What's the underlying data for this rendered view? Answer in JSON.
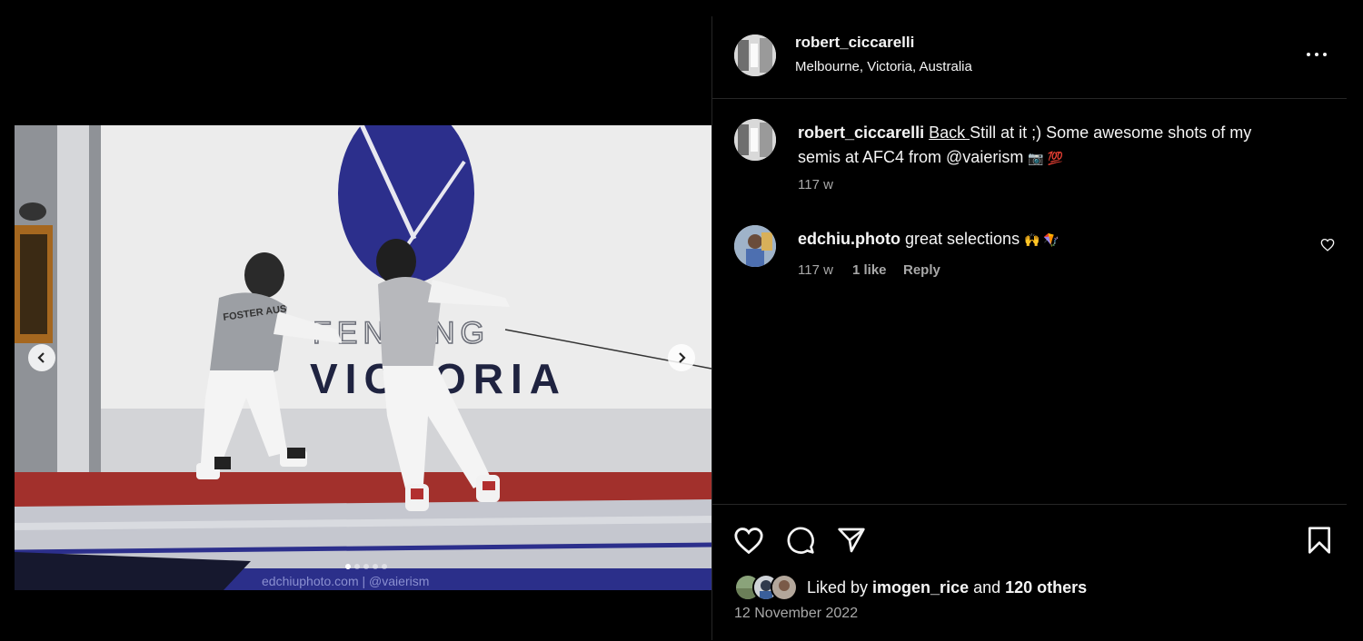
{
  "post": {
    "watermark": "edchiuphoto.com | @vaierism",
    "banner_top": "FENCING",
    "banner_bottom": "VICTORIA",
    "fencer_back": "FOSTER AUS",
    "carousel_count": 5,
    "carousel_active": 1
  },
  "header": {
    "username": "robert_ciccarelli",
    "location": "Melbourne, Victoria, Australia",
    "more_icon": "more-horizontal-icon"
  },
  "caption": {
    "username": "robert_ciccarelli",
    "link_text": "Back ",
    "text_line1": "Still at it ;) Some awesome shots of my",
    "text_line2": "semis at AFC4 from @vaierism",
    "emojis": "📷 💯",
    "time": "117 w"
  },
  "comments": [
    {
      "username": "edchiu.photo",
      "text": "great selections",
      "emojis": "🙌 🪁",
      "time": "117 w",
      "likes": "1 like",
      "reply_label": "Reply"
    }
  ],
  "actions": {
    "like_icon": "heart-icon",
    "comment_icon": "comment-icon",
    "share_icon": "paper-plane-icon",
    "save_icon": "bookmark-icon"
  },
  "likes": {
    "prefix": "Liked by ",
    "user": "imogen_rice",
    "middle": " and ",
    "others": "120 others"
  },
  "date": "12 November 2022",
  "colors": {
    "background": "#000000",
    "text": "#f5f5f5",
    "muted": "#a8a8a8",
    "divider": "#262626"
  }
}
